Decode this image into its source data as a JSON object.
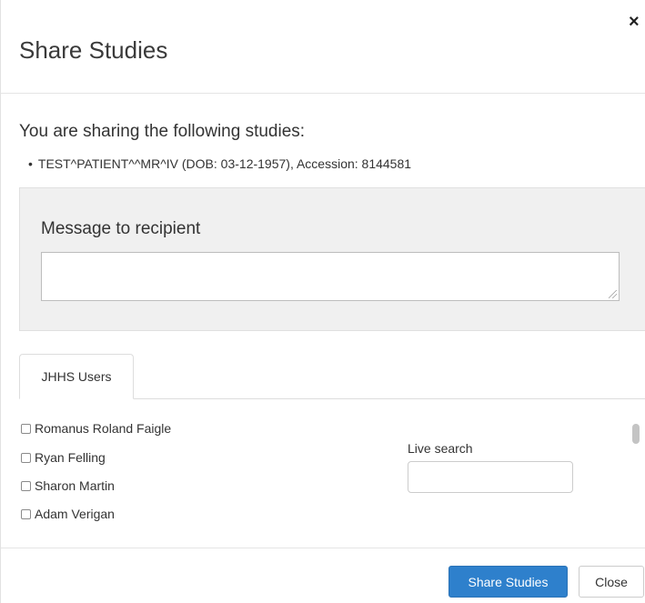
{
  "dialog": {
    "title": "Share Studies",
    "close_icon": "×"
  },
  "studies": {
    "intro": "You are sharing the following studies:",
    "items": [
      "TEST^PATIENT^^MR^IV (DOB: 03-12-1957), Accession: 8144581"
    ]
  },
  "message": {
    "label": "Message to recipient",
    "value": ""
  },
  "tabs": [
    {
      "label": "JHHS Users",
      "active": true
    }
  ],
  "users": [
    {
      "name": "Romanus Roland Faigle",
      "checked": false
    },
    {
      "name": "Ryan Felling",
      "checked": false
    },
    {
      "name": "Sharon Martin",
      "checked": false
    },
    {
      "name": "Adam Verigan",
      "checked": false
    }
  ],
  "live_search": {
    "label": "Live search",
    "value": ""
  },
  "footer": {
    "share_label": "Share Studies",
    "close_label": "Close"
  },
  "colors": {
    "primary": "#2e80cc",
    "panel_bg": "#f0f0f0"
  }
}
